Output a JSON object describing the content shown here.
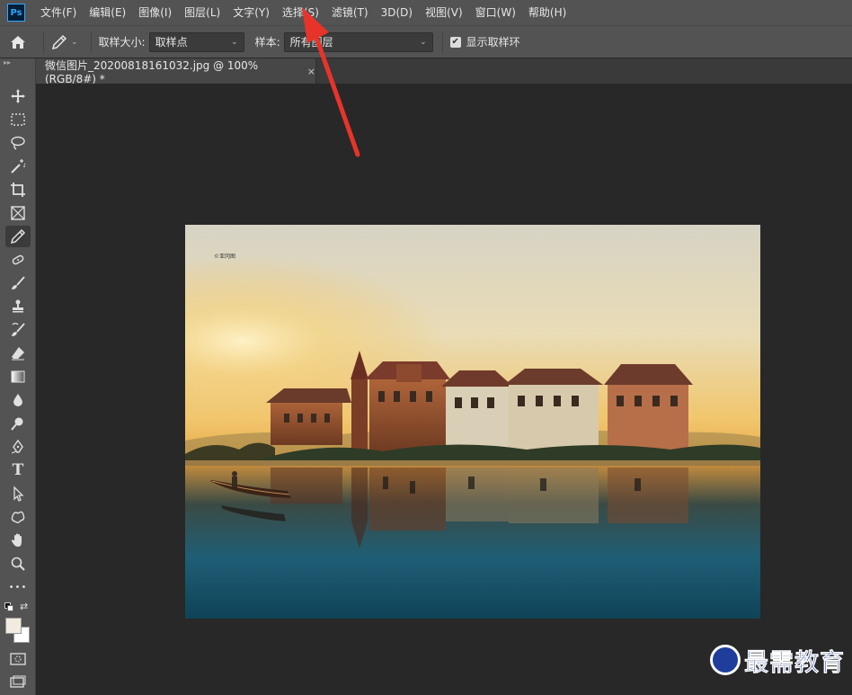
{
  "menubar": {
    "logo": "Ps",
    "items": [
      {
        "label": "文件(F)"
      },
      {
        "label": "编辑(E)"
      },
      {
        "label": "图像(I)"
      },
      {
        "label": "图层(L)"
      },
      {
        "label": "文字(Y)"
      },
      {
        "label": "选择(S)"
      },
      {
        "label": "滤镜(T)"
      },
      {
        "label": "3D(D)"
      },
      {
        "label": "视图(V)"
      },
      {
        "label": "窗口(W)"
      },
      {
        "label": "帮助(H)"
      }
    ]
  },
  "options": {
    "sample_size_label": "取样大小:",
    "sample_size_value": "取样点",
    "sample_label": "样本:",
    "sample_value": "所有图层",
    "show_ring_label": "显示取样环",
    "show_ring_checked": "✔"
  },
  "document": {
    "tab_title": "微信图片_20200818161032.jpg @ 100%(RGB/8#) *",
    "close_glyph": "×",
    "photo_caption": "©亚冈图"
  },
  "toolbar": {
    "grip": "▸▸",
    "tools": [
      {
        "name": "move-tool",
        "icon": "move-icon"
      },
      {
        "name": "marquee-tool",
        "icon": "marquee-icon"
      },
      {
        "name": "lasso-tool",
        "icon": "lasso-icon"
      },
      {
        "name": "magic-wand-tool",
        "icon": "magic-wand-icon"
      },
      {
        "name": "crop-tool",
        "icon": "crop-icon"
      },
      {
        "name": "frame-tool",
        "icon": "frame-icon"
      },
      {
        "name": "eyedropper-tool",
        "icon": "eyedropper-icon"
      },
      {
        "name": "healing-tool",
        "icon": "healing-icon"
      },
      {
        "name": "brush-tool",
        "icon": "brush-icon"
      },
      {
        "name": "stamp-tool",
        "icon": "stamp-icon"
      },
      {
        "name": "history-brush-tool",
        "icon": "history-brush-icon"
      },
      {
        "name": "eraser-tool",
        "icon": "eraser-icon"
      },
      {
        "name": "gradient-tool",
        "icon": "gradient-icon"
      },
      {
        "name": "blur-tool",
        "icon": "drop-icon"
      },
      {
        "name": "dodge-tool",
        "icon": "dodge-icon"
      },
      {
        "name": "pen-tool",
        "icon": "pen-icon"
      },
      {
        "name": "type-tool",
        "icon": "type-icon"
      },
      {
        "name": "path-select-tool",
        "icon": "arrow-icon"
      },
      {
        "name": "shape-tool",
        "icon": "shape-icon"
      },
      {
        "name": "hand-tool",
        "icon": "hand-icon"
      },
      {
        "name": "zoom-tool",
        "icon": "zoom-icon"
      },
      {
        "name": "more-tools",
        "icon": "ellipsis-icon"
      }
    ],
    "type_glyph": "T",
    "more_glyph": "•••"
  },
  "colors": {
    "foreground": "#f2ebe0",
    "background": "#ffffff",
    "annotation_arrow": "#e8332a"
  },
  "watermark": {
    "text": "最需教育"
  }
}
